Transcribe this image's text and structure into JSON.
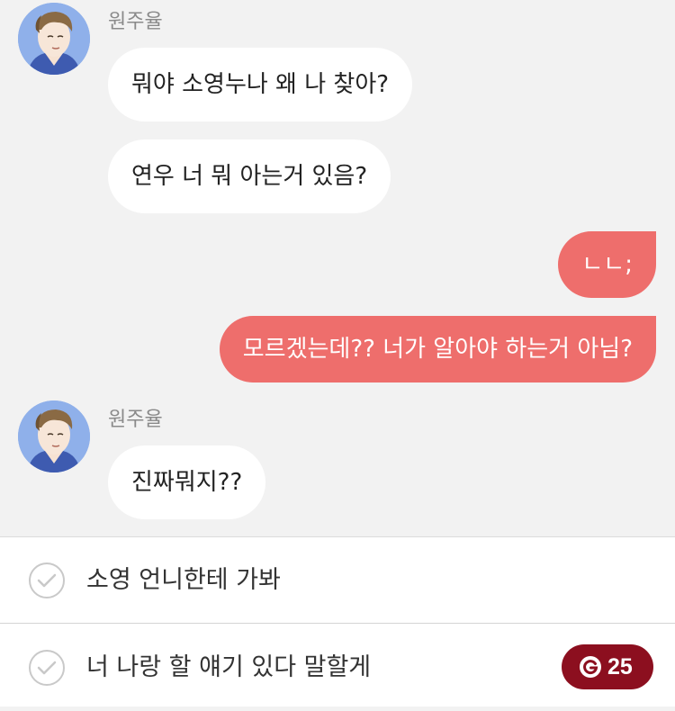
{
  "chat": {
    "messages": [
      {
        "sender": "원주율",
        "text": "뭐야 소영누나 왜 나 찾아?"
      },
      {
        "sender": "원주율",
        "text": "연우 너 뭐 아는거 있음?"
      },
      {
        "sender": "me",
        "text": "ㄴㄴ;"
      },
      {
        "sender": "me",
        "text": "모르겠는데?? 너가 알아야 하는거 아님?"
      },
      {
        "sender": "원주율",
        "text": "진짜뭐지??"
      }
    ],
    "contact_name": "원주율",
    "colors": {
      "incoming_bubble": "#ffffff",
      "outgoing_bubble": "#ee6e6c",
      "background": "#f2f2f2"
    }
  },
  "choices": [
    {
      "label": "소영 언니한테 가봐",
      "cost": null
    },
    {
      "label": "너 나랑 할 얘기 있다 말할게",
      "cost": "25",
      "cost_icon": "coin-g-icon"
    }
  ],
  "colors": {
    "cost_badge": "#8c0f1f",
    "check_outline": "#c9c9c9"
  }
}
